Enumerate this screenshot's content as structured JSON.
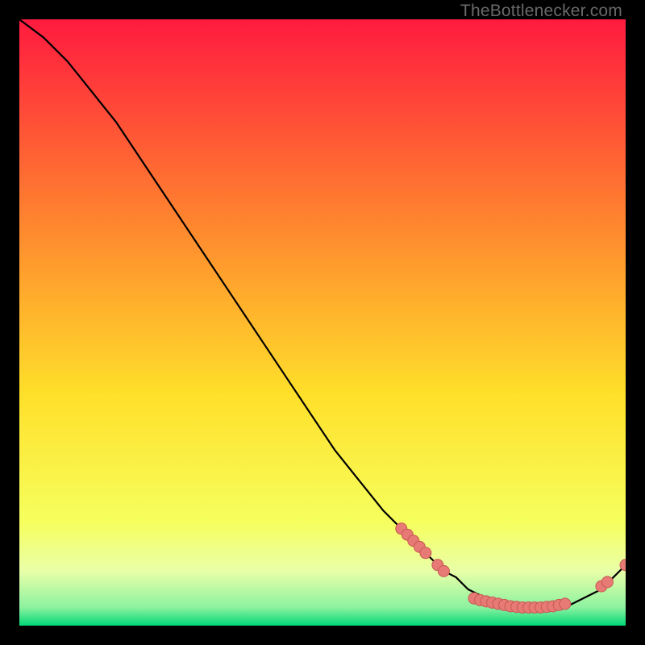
{
  "attribution": "TheBottlenecker.com",
  "colors": {
    "bg": "#000000",
    "gradient_top": "#ff1a3f",
    "gradient_mid_upper": "#ff7a2e",
    "gradient_mid": "#ffe02a",
    "gradient_lower": "#f7ff69",
    "gradient_bottom": "#00d877",
    "curve": "#000000",
    "marker_fill": "#e77a74",
    "marker_stroke": "#c85a54"
  },
  "chart_data": {
    "type": "line",
    "title": "",
    "xlabel": "",
    "ylabel": "",
    "xlim": [
      0,
      100
    ],
    "ylim": [
      0,
      100
    ],
    "x": [
      0,
      4,
      8,
      12,
      16,
      20,
      24,
      28,
      32,
      36,
      40,
      44,
      48,
      52,
      56,
      60,
      64,
      68,
      70,
      72,
      74,
      76,
      78,
      80,
      82,
      84,
      86,
      88,
      90,
      92,
      94,
      96,
      98,
      100
    ],
    "y": [
      100,
      97,
      93,
      88,
      83,
      77,
      71,
      65,
      59,
      53,
      47,
      41,
      35,
      29,
      24,
      19,
      15,
      11,
      9,
      8,
      6,
      5,
      4,
      3,
      3,
      3,
      3,
      3,
      3,
      4,
      5,
      6,
      8,
      10
    ],
    "markers": [
      {
        "x": 63,
        "y": 16
      },
      {
        "x": 64,
        "y": 15
      },
      {
        "x": 65,
        "y": 14
      },
      {
        "x": 66,
        "y": 13
      },
      {
        "x": 67,
        "y": 12
      },
      {
        "x": 69,
        "y": 10
      },
      {
        "x": 70,
        "y": 9
      },
      {
        "x": 75,
        "y": 4.5
      },
      {
        "x": 76,
        "y": 4.2
      },
      {
        "x": 77,
        "y": 4.0
      },
      {
        "x": 78,
        "y": 3.8
      },
      {
        "x": 79,
        "y": 3.6
      },
      {
        "x": 80,
        "y": 3.4
      },
      {
        "x": 81,
        "y": 3.2
      },
      {
        "x": 82,
        "y": 3.1
      },
      {
        "x": 83,
        "y": 3.0
      },
      {
        "x": 84,
        "y": 3.0
      },
      {
        "x": 85,
        "y": 3.0
      },
      {
        "x": 86,
        "y": 3.0
      },
      {
        "x": 87,
        "y": 3.1
      },
      {
        "x": 88,
        "y": 3.2
      },
      {
        "x": 89,
        "y": 3.4
      },
      {
        "x": 90,
        "y": 3.6
      },
      {
        "x": 96,
        "y": 6.5
      },
      {
        "x": 97,
        "y": 7.2
      },
      {
        "x": 100,
        "y": 10
      }
    ]
  }
}
